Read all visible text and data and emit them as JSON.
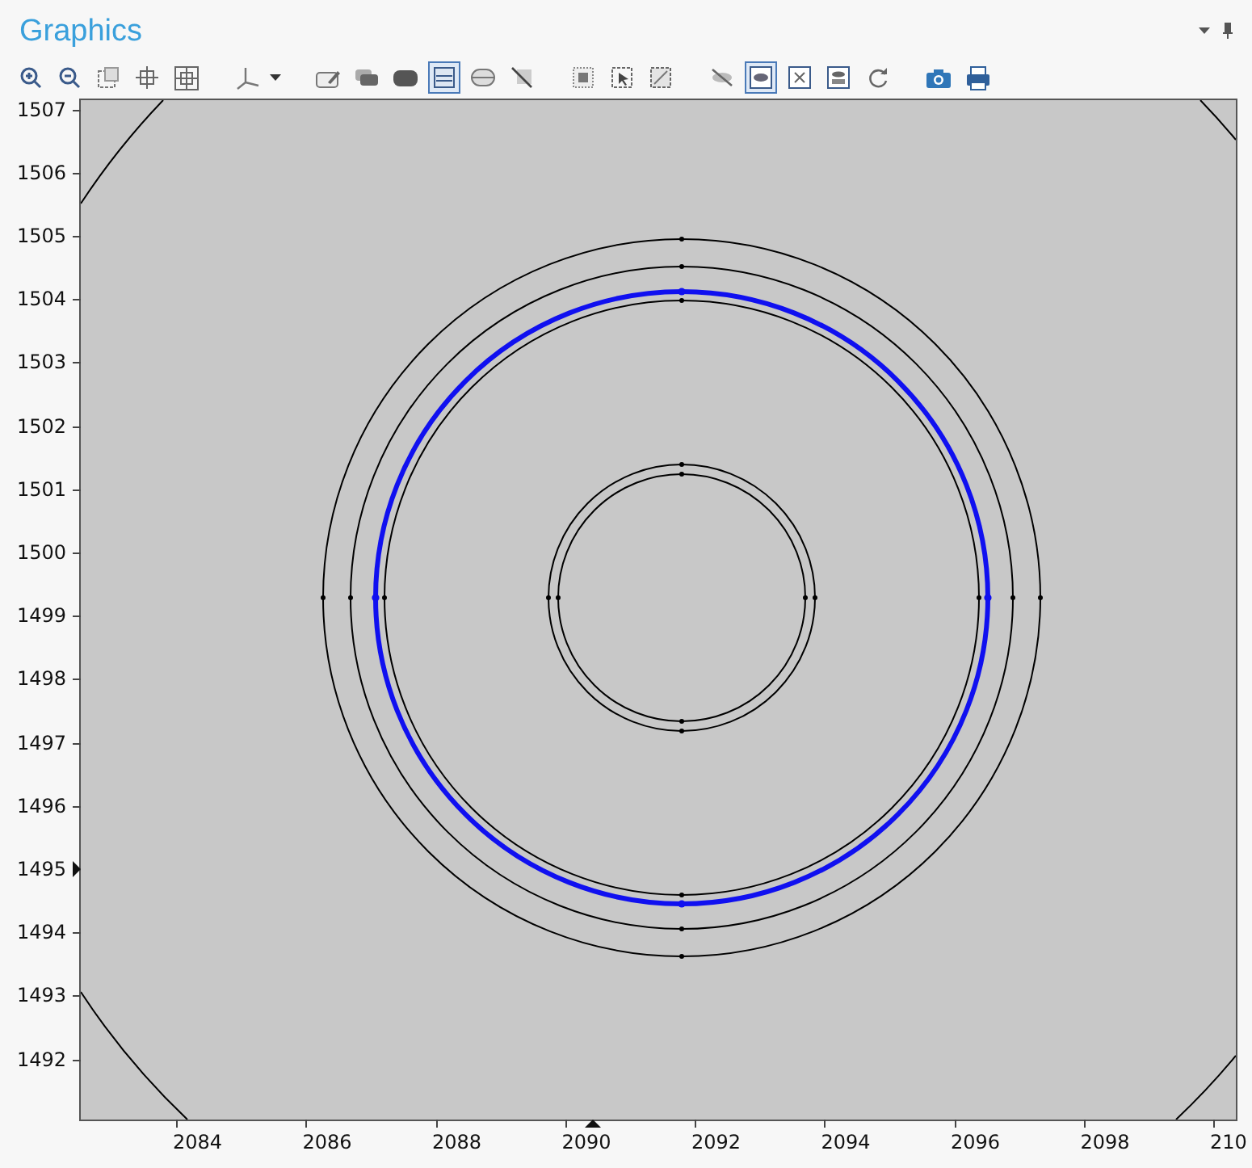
{
  "window": {
    "title": "Graphics"
  },
  "toolbar_groups": [
    [
      {
        "kind": "zoom-in",
        "selected": false
      },
      {
        "kind": "zoom-out",
        "selected": false
      },
      {
        "kind": "dashed-square",
        "selected": false
      },
      {
        "kind": "crosshair",
        "selected": false
      },
      {
        "kind": "crosshair-frame",
        "selected": false
      }
    ],
    [
      {
        "kind": "axes",
        "selected": false
      },
      {
        "kind": "caret",
        "selected": false
      }
    ],
    [
      {
        "kind": "pencil-frame",
        "selected": false
      },
      {
        "kind": "grey-block",
        "selected": false
      },
      {
        "kind": "dark-block",
        "selected": false
      },
      {
        "kind": "layers",
        "selected": true
      },
      {
        "kind": "lens",
        "selected": false
      },
      {
        "kind": "slash",
        "selected": false
      }
    ],
    [
      {
        "kind": "dotted-square",
        "selected": false
      },
      {
        "kind": "select-square",
        "selected": false
      },
      {
        "kind": "select-frame",
        "selected": false
      }
    ],
    [
      {
        "kind": "eye-slash",
        "selected": false
      },
      {
        "kind": "eye",
        "selected": true
      },
      {
        "kind": "cross-frame",
        "selected": false
      },
      {
        "kind": "stack-frame",
        "selected": false
      },
      {
        "kind": "rotate",
        "selected": false
      }
    ],
    [
      {
        "kind": "camera",
        "selected": false
      },
      {
        "kind": "printer",
        "selected": false
      }
    ]
  ],
  "plot": {
    "y_ticks": [
      "1507",
      "1506",
      "1505",
      "1504",
      "1503",
      "1502",
      "1501",
      "1500",
      "1499",
      "1498",
      "1497",
      "1496",
      "1495",
      "1494",
      "1493",
      "1492"
    ],
    "x_ticks": [
      "2084",
      "2086",
      "2088",
      "2090",
      "2092",
      "2094",
      "2096",
      "2098",
      "210"
    ]
  }
}
